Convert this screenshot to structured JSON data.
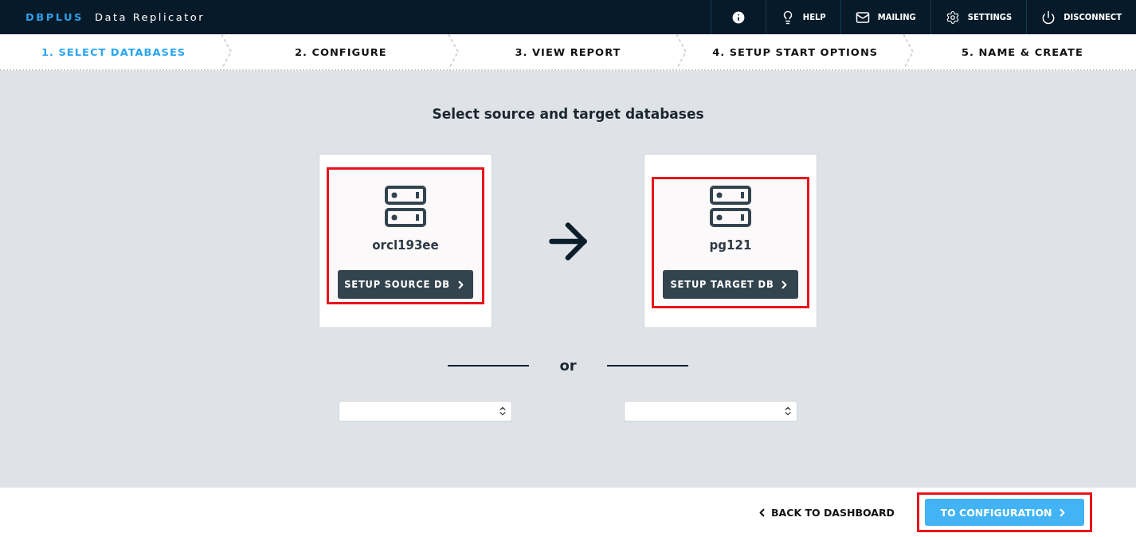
{
  "header": {
    "brand": "DBPLUS",
    "product": "Data Replicator",
    "actions": [
      {
        "kind": "info"
      },
      {
        "kind": "help",
        "label": "HELP"
      },
      {
        "kind": "mail",
        "label": "MAILING"
      },
      {
        "kind": "settings",
        "label": "SETTINGS"
      },
      {
        "kind": "power",
        "label": "DISCONNECT"
      }
    ]
  },
  "steps": [
    {
      "label": "1. SELECT DATABASES",
      "selected": true
    },
    {
      "label": "2. CONFIGURE",
      "selected": false
    },
    {
      "label": "3. VIEW REPORT",
      "selected": false
    },
    {
      "label": "4. SETUP START OPTIONS",
      "selected": false
    },
    {
      "label": "5. NAME & CREATE",
      "selected": false
    }
  ],
  "heading": "Select source and target databases",
  "databases": [
    {
      "name": "orcl193ee",
      "button": "SETUP SOURCE DB",
      "highlighted": true
    },
    {
      "name": "pg121",
      "button": "SETUP TARGET DB",
      "highlighted": true
    }
  ],
  "separator": "or",
  "footer": {
    "back": "BACK TO DASHBOARD",
    "next": {
      "label": "TO CONFIGURATION",
      "highlighted": true
    }
  }
}
